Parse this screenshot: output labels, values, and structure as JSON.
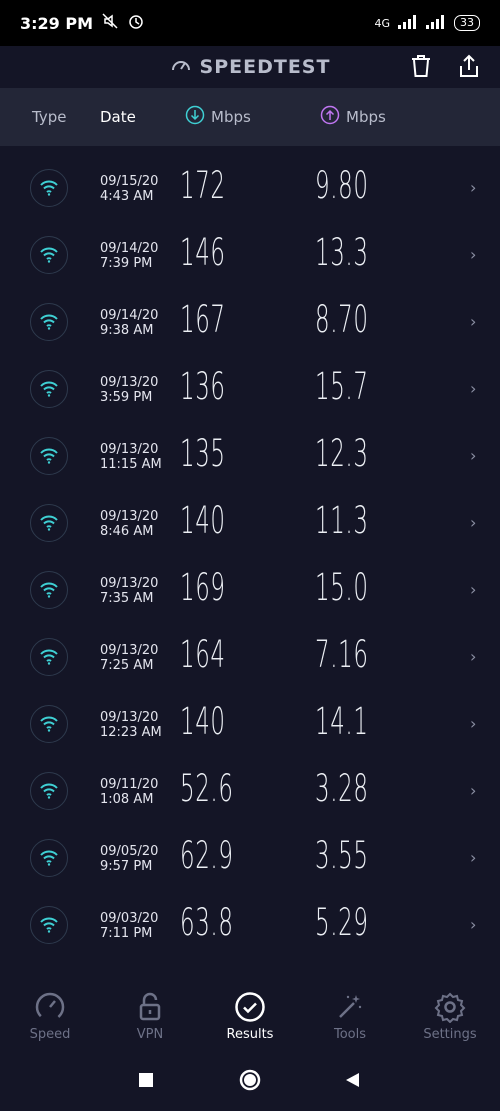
{
  "status": {
    "time": "3:29 PM",
    "network": "4G",
    "battery": "33"
  },
  "app": {
    "title": "SPEEDTEST"
  },
  "header": {
    "type": "Type",
    "date": "Date",
    "download": "Mbps",
    "upload": "Mbps"
  },
  "results": [
    {
      "date": "09/15/20",
      "time": "4:43 AM",
      "down": "172",
      "up": "9.80"
    },
    {
      "date": "09/14/20",
      "time": "7:39 PM",
      "down": "146",
      "up": "13.3"
    },
    {
      "date": "09/14/20",
      "time": "9:38 AM",
      "down": "167",
      "up": "8.70"
    },
    {
      "date": "09/13/20",
      "time": "3:59 PM",
      "down": "136",
      "up": "15.7"
    },
    {
      "date": "09/13/20",
      "time": "11:15 AM",
      "down": "135",
      "up": "12.3"
    },
    {
      "date": "09/13/20",
      "time": "8:46 AM",
      "down": "140",
      "up": "11.3"
    },
    {
      "date": "09/13/20",
      "time": "7:35 AM",
      "down": "169",
      "up": "15.0"
    },
    {
      "date": "09/13/20",
      "time": "7:25 AM",
      "down": "164",
      "up": "7.16"
    },
    {
      "date": "09/13/20",
      "time": "12:23 AM",
      "down": "140",
      "up": "14.1"
    },
    {
      "date": "09/11/20",
      "time": "1:08 AM",
      "down": "52.6",
      "up": "3.28"
    },
    {
      "date": "09/05/20",
      "time": "9:57 PM",
      "down": "62.9",
      "up": "3.55"
    },
    {
      "date": "09/03/20",
      "time": "7:11 PM",
      "down": "63.8",
      "up": "5.29"
    }
  ],
  "nav": {
    "speed": "Speed",
    "vpn": "VPN",
    "results": "Results",
    "tools": "Tools",
    "settings": "Settings"
  },
  "colors": {
    "accent_download": "#3fd0d4",
    "accent_upload": "#c076f2",
    "background": "#141526"
  },
  "icons": [
    "wifi-icon",
    "speedometer-icon",
    "trash-icon",
    "share-icon",
    "download-arrow-icon",
    "upload-arrow-icon",
    "lock-icon",
    "check-circle-icon",
    "magic-wand-icon",
    "gear-icon",
    "chevron-right-icon"
  ]
}
